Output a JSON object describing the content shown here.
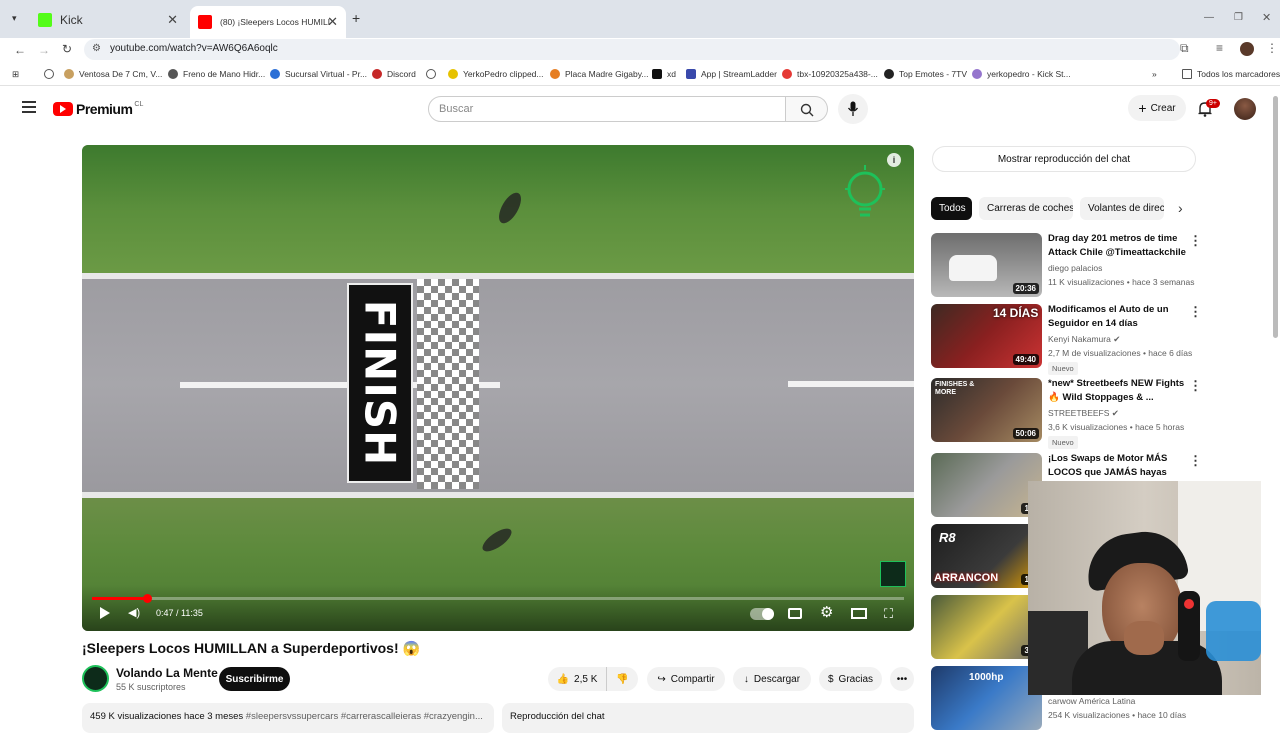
{
  "browser": {
    "tabs": [
      {
        "title": "Kick",
        "active": false
      },
      {
        "title": "(80) ¡Sleepers Locos HUMILLAN",
        "active": true
      }
    ],
    "new_tab": "+",
    "url": "youtube.com/watch?v=AW6Q6A6oqlc",
    "bookmarks": [
      "Ventosa De 7 Cm, V...",
      "Freno de Mano Hidr...",
      "Sucursal Virtual - Pr...",
      "Discord",
      "YerkoPedro clipped...",
      "Placa Madre Gigaby...",
      "xd",
      "App | StreamLadder",
      "tbx-10920325a438-...",
      "Top Emotes - 7TV",
      "yerkopedro - Kick St..."
    ],
    "all_bookmarks": "Todos los marcadores"
  },
  "youtube": {
    "logo": "Premium",
    "region": "CL",
    "search_placeholder": "Buscar",
    "create_label": "Crear",
    "notif_badge": "9+"
  },
  "player": {
    "finish_text": "FINISH",
    "time": "0:47 / 11:35",
    "progress_fraction": 0.068
  },
  "video": {
    "title": "¡Sleepers Locos HUMILLAN a Superdeportivos! 😱",
    "channel": "Volando La Mente",
    "subscribers": "55 K suscriptores",
    "subscribe_label": "Suscribirme",
    "likes": "2,5 K",
    "share_label": "Compartir",
    "download_label": "Descargar",
    "thanks_label": "Gracias",
    "desc_stats": "459 K visualizaciones  hace 3 meses",
    "desc_tags": "#sleepersvssupercars #carrerascalleieras #crazyengin...",
    "chat_replay": "Reproducción del chat"
  },
  "sidebar": {
    "show_chat": "Mostrar reproducción del chat",
    "chips": [
      "Todos",
      "Carreras de coches",
      "Volantes de direcc"
    ],
    "items": [
      {
        "title": "Drag day 201 metros de time Attack Chile @Timeattackchile",
        "channel": "diego palacios",
        "meta": "11 K visualizaciones • hace 3 semanas",
        "duration": "20:36",
        "nuevo": ""
      },
      {
        "title": "Modificamos el Auto de un Seguidor en 14 días",
        "channel": "Kenyi Nakamura ✔",
        "meta": "2,7 M de visualizaciones • hace 6 días",
        "duration": "49:40",
        "nuevo": "Nuevo"
      },
      {
        "title": "*new* Streetbeefs NEW Fights 🔥 Wild Stoppages & ...",
        "channel": "STREETBEEFS ✔",
        "meta": "3,6 K visualizaciones • hace 5 horas",
        "duration": "50:06",
        "nuevo": "Nuevo"
      },
      {
        "title": "¡Los Swaps de Motor MÁS LOCOS que JAMÁS hayas visto!",
        "channel": "",
        "meta": "",
        "duration": "13:",
        "nuevo": ""
      },
      {
        "title": "",
        "channel": "",
        "meta": "",
        "duration": "18:",
        "nuevo": ""
      },
      {
        "title": "",
        "channel": "",
        "meta": "",
        "duration": "34:",
        "nuevo": ""
      },
      {
        "title": "",
        "channel": "carwow América Latina",
        "meta": "254 K visualizaciones • hace 10 días",
        "duration": "",
        "nuevo": ""
      }
    ],
    "thumb_labels": {
      "t2": "14 DÍAS",
      "t3": "FINISHES & MORE",
      "t5a": "R8",
      "t5b": "ARRANCON",
      "t7": "1000hp"
    }
  }
}
